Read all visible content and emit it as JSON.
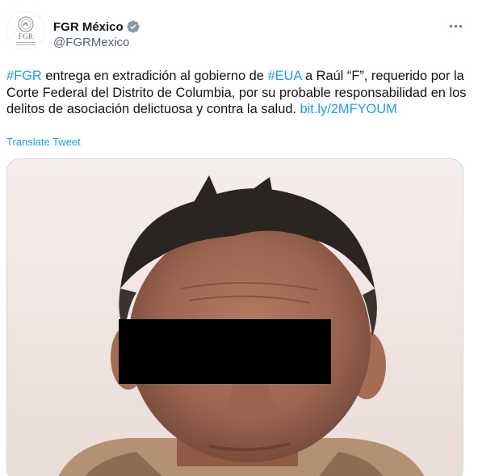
{
  "author": {
    "display_name": "FGR México",
    "handle": "@FGRMexico",
    "avatar_text": "FGR",
    "verified": true
  },
  "tweet": {
    "segments": [
      {
        "type": "hashtag",
        "text": "#FGR"
      },
      {
        "type": "text",
        "text": " entrega en extradición al gobierno de "
      },
      {
        "type": "hashtag",
        "text": "#EUA"
      },
      {
        "type": "text",
        "text": " a Raúl “F”, requerido por la Corte Federal del Distrito de Columbia, por su probable responsabilidad en los delitos de asociación delictuosa y contra la salud. "
      },
      {
        "type": "link",
        "text": "bit.ly/2MFYOUM"
      }
    ],
    "translate_label": "Translate Tweet"
  },
  "media": {
    "icon": "photo-of-man-with-censored-eyes"
  },
  "colors": {
    "link": "#1d9bf0",
    "secondary_text": "#536471",
    "border": "#cfd9de"
  }
}
